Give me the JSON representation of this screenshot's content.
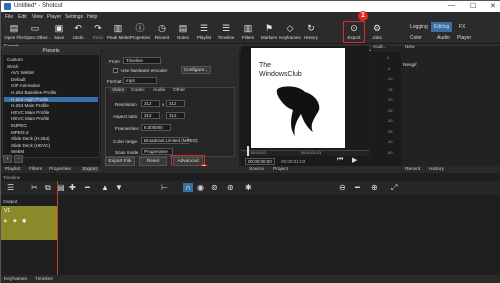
{
  "window": {
    "title": "Untitled* - Shotcut",
    "min": "—",
    "max": "☐",
    "close": "✕"
  },
  "menu": [
    "File",
    "Edit",
    "View",
    "Player",
    "Settings",
    "Help"
  ],
  "toolbar": [
    {
      "label": "Open File",
      "icon": "open-file-icon",
      "glyph": "▤"
    },
    {
      "label": "Open Other...",
      "icon": "open-other-icon",
      "glyph": "▭"
    },
    {
      "label": "Save",
      "icon": "save-icon",
      "glyph": "▣"
    },
    {
      "label": "Undo",
      "icon": "undo-icon",
      "glyph": "↶"
    },
    {
      "label": "Redo",
      "icon": "redo-icon",
      "glyph": "↷"
    },
    {
      "label": "Peak Meter",
      "icon": "peak-meter-icon",
      "glyph": "▥"
    },
    {
      "label": "Properties",
      "icon": "properties-icon",
      "glyph": "ⓘ"
    },
    {
      "label": "Recent",
      "icon": "recent-icon",
      "glyph": "◷"
    },
    {
      "label": "Notes",
      "icon": "notes-icon",
      "glyph": "▤"
    },
    {
      "label": "Playlist",
      "icon": "playlist-icon",
      "glyph": "☰"
    },
    {
      "label": "Timeline",
      "icon": "timeline-icon",
      "glyph": "☰"
    },
    {
      "label": "Filters",
      "icon": "filters-icon",
      "glyph": "▥"
    },
    {
      "label": "Markers",
      "icon": "markers-icon",
      "glyph": "⚑"
    },
    {
      "label": "Keyframes",
      "icon": "keyframes-icon",
      "glyph": "◇"
    },
    {
      "label": "History",
      "icon": "history-icon",
      "glyph": "↻"
    },
    {
      "label": "Export",
      "icon": "export-icon",
      "glyph": "⊙"
    },
    {
      "label": "Jobs",
      "icon": "jobs-icon",
      "glyph": "⚙"
    }
  ],
  "modes": {
    "top": [
      "Logging",
      "Editing",
      "FX"
    ],
    "bottom": [
      "Color",
      "Audio",
      "Player"
    ],
    "active": "Editing"
  },
  "export_tooltip": "Export",
  "annotations": [
    "1",
    "2"
  ],
  "presets": {
    "header_left": "Export",
    "title": "Presets",
    "items": [
      "Custom",
      "Stock",
      "AV1 WebM",
      "Default",
      "GIF Animation",
      "H.264 Baseline Profile",
      "H.264 High Profile",
      "H.264 Main Profile",
      "HEVC Main Profile",
      "HEVC Main Profile",
      "MJPEG",
      "MPEG-2",
      "Slide Deck (H.264)",
      "Slide Deck (HEVC)",
      "WebM"
    ],
    "selected": "H.264 High Profile",
    "add": "+",
    "remove": "−"
  },
  "export": {
    "from_label": "From",
    "from_value": "Timeline",
    "hw_label": "Use hardware encoder",
    "configure": "Configure...",
    "format_label": "Format",
    "format_value": "mp4",
    "tabs": [
      "Video",
      "Codec",
      "Audio",
      "Other"
    ],
    "resolution_label": "Resolution",
    "res_w": "312",
    "res_h": "312",
    "aspect_label": "Aspect ratio",
    "aspect_w": "312",
    "aspect_h": "312",
    "fps_label": "Frames/sec",
    "fps_value": "8.000000",
    "scan_label": "Scan mode",
    "scan_value": "Progressive",
    "color_label": "Color range",
    "color_value": "Broadcast Limited (MPEG)",
    "export_file": "Export File",
    "reset": "Reset",
    "advanced": "Advanced"
  },
  "preview": {
    "logo_line1": "The",
    "logo_line2": "WindowsClub",
    "timecode_current": "00:00:00:00",
    "timecode_total": "00:00:01:03",
    "ruler_start": "00:00:00",
    "ruler_mark": "00:00:00:13"
  },
  "right_panel": {
    "tabs": [
      "Audi...",
      "New"
    ],
    "file": "Nesgif",
    "db_labels": [
      "0",
      "-5",
      "-10",
      "-15",
      "-20",
      "-25",
      "-30",
      "-35",
      "-40",
      "-50"
    ]
  },
  "bottom_tabs_left": [
    "Playlist",
    "Filters",
    "Properties",
    "Export"
  ],
  "bottom_tabs_mid": [
    "Source",
    "Project"
  ],
  "bottom_tabs_right": [
    "Recent",
    "History"
  ],
  "timeline": {
    "header": "Timeline",
    "output": "Output",
    "track": "V1",
    "bottom_tabs": [
      "Keyframes",
      "Timeline"
    ]
  },
  "colors": {
    "accent": "#3b6ea5",
    "highlight": "#e02828",
    "track": "#8a8a2a"
  }
}
